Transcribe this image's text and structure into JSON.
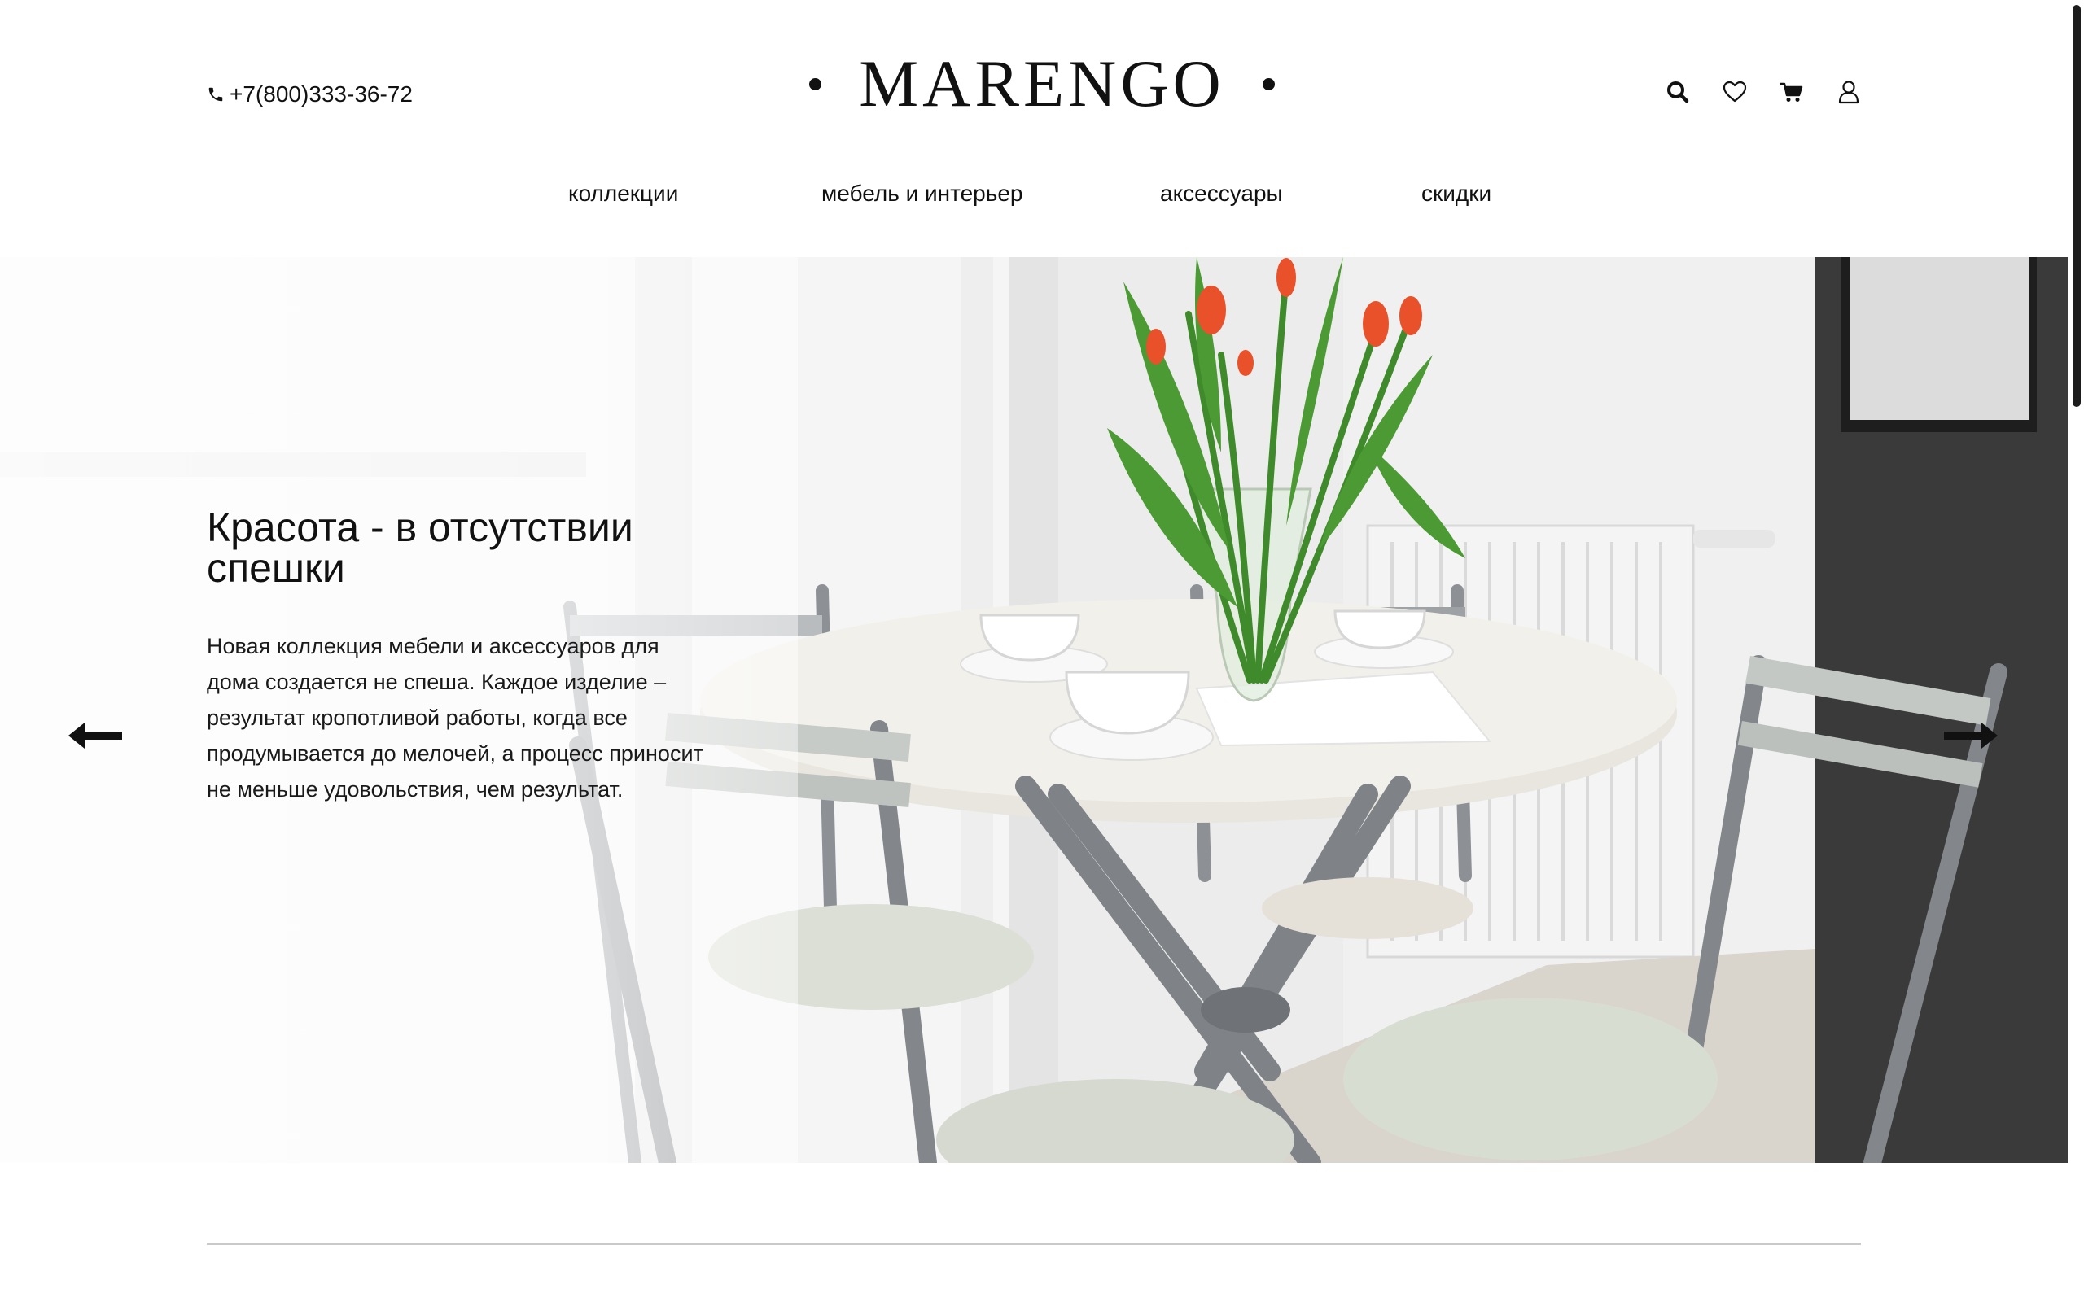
{
  "header": {
    "phone": "+7(800)333-36-72",
    "logo": "MARENGO"
  },
  "icons": [
    "search-icon",
    "heart-icon",
    "cart-icon",
    "user-icon"
  ],
  "nav": [
    {
      "label": "коллекции"
    },
    {
      "label": "мебель и интерьер"
    },
    {
      "label": "аксессуары"
    },
    {
      "label": "скидки"
    }
  ],
  "hero": {
    "title": "Красота - в отсутствии спешки",
    "text": "Новая коллекция мебели и аксессуаров для дома создается не спеша. Каждое изделие – результат кропотливой работы, когда все продумывается до мелочей, а процесс приносит не меньше удовольствия, чем результат."
  },
  "colors": {
    "text": "#111111",
    "wall_dark": "#3a3a3a",
    "tulip": "#e8512a",
    "leaf": "#3f8a2a",
    "chair": "#d8ddd2"
  }
}
